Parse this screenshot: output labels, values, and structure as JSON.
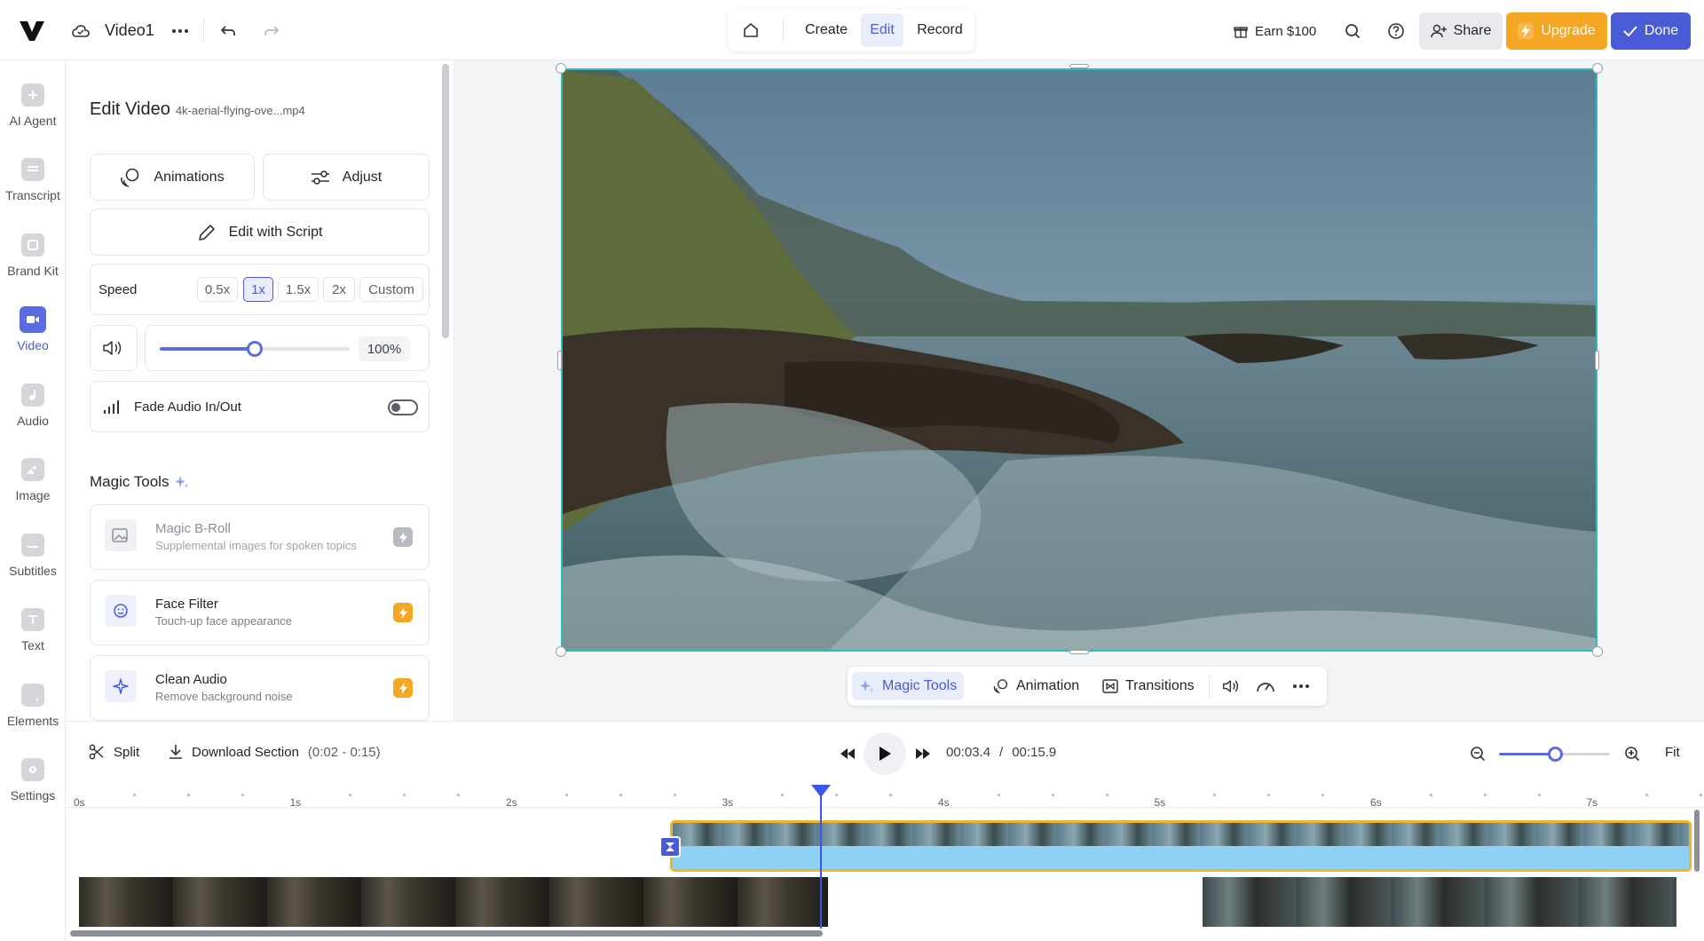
{
  "topbar": {
    "project_title": "Video1",
    "tabs": [
      "Create",
      "Edit",
      "Record"
    ],
    "active_tab": "Edit",
    "earn_label": "Earn $100",
    "share_label": "Share",
    "upgrade_label": "Upgrade",
    "done_label": "Done"
  },
  "rail": {
    "items": [
      {
        "label": "AI Agent",
        "icon": "sparkle-plus-icon"
      },
      {
        "label": "Transcript",
        "icon": "transcript-icon"
      },
      {
        "label": "Brand Kit",
        "icon": "brand-kit-icon"
      },
      {
        "label": "Video",
        "icon": "video-camera-icon"
      },
      {
        "label": "Audio",
        "icon": "music-note-icon"
      },
      {
        "label": "Image",
        "icon": "image-icon"
      },
      {
        "label": "Subtitles",
        "icon": "subtitles-icon"
      },
      {
        "label": "Text",
        "icon": "text-icon"
      },
      {
        "label": "Elements",
        "icon": "elements-icon"
      },
      {
        "label": "Settings",
        "icon": "gear-icon"
      }
    ],
    "active": "Video"
  },
  "panel": {
    "heading": "Edit Video",
    "filename": "4k-aerial-flying-ove...mp4",
    "animations_label": "Animations",
    "adjust_label": "Adjust",
    "script_label": "Edit with Script",
    "speed_label": "Speed",
    "speed_options": [
      "0.5x",
      "1x",
      "1.5x",
      "2x",
      "Custom"
    ],
    "speed_selected": "1x",
    "volume_value": "100%",
    "volume_level": 0.5,
    "fade_label": "Fade Audio In/Out",
    "fade_on": false,
    "magic_heading": "Magic Tools",
    "tools": [
      {
        "title": "Magic B-Roll",
        "subtitle": "Supplemental images for spoken topics",
        "icon": "image-sparkle-icon",
        "disabled": true
      },
      {
        "title": "Face Filter",
        "subtitle": "Touch-up face appearance",
        "icon": "face-filter-icon",
        "disabled": false
      },
      {
        "title": "Clean Audio",
        "subtitle": "Remove background noise",
        "icon": "sparkle-icon",
        "disabled": false
      }
    ]
  },
  "context_toolbar": {
    "magic_tools": "Magic Tools",
    "animation": "Animation",
    "transitions": "Transitions"
  },
  "timeline": {
    "split_label": "Split",
    "download_label": "Download Section",
    "download_range": "(0:02 - 0:15)",
    "current_time": "00:03.4",
    "separator": "/",
    "total_time": "00:15.9",
    "fit_label": "Fit",
    "zoom_level": 0.5,
    "ruler": [
      "0s",
      "1s",
      "2s",
      "3s",
      "4s",
      "5s",
      "6s",
      "7s"
    ]
  },
  "colors": {
    "accent": "#4a5bd6",
    "upgrade": "#f5a623",
    "clip_border": "#f0b429",
    "playhead": "#3b55e6"
  }
}
